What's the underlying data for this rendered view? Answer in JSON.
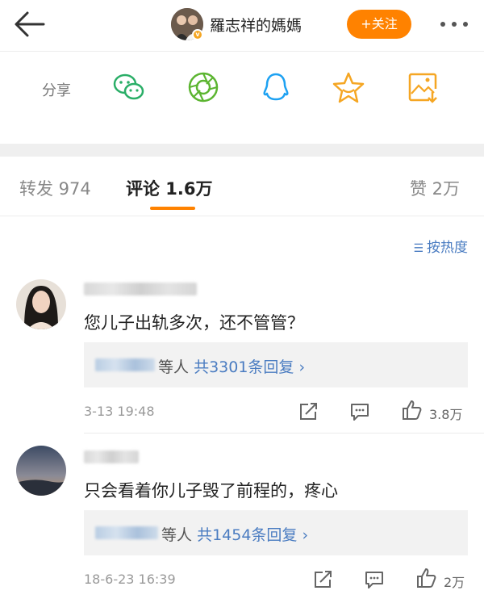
{
  "header": {
    "username": "羅志祥的媽媽",
    "follow_label": "+关注"
  },
  "share": {
    "label": "分享",
    "targets": [
      "wechat",
      "moments",
      "qq",
      "favorite",
      "save-image"
    ]
  },
  "tabs": [
    {
      "label": "转发 974"
    },
    {
      "label": "评论 1.6万"
    },
    {
      "label": "赞 2万"
    }
  ],
  "sort_label": "按热度",
  "comments": [
    {
      "text": "您儿子出轨多次，还不管管？",
      "reply_who": "等人",
      "reply_count": "共3301条回复 ›",
      "time": "3-13 19:48",
      "likes": "3.8万"
    },
    {
      "text": "只会看着你儿子毁了前程的，疼心",
      "reply_who": "等人",
      "reply_count": "共1454条回复 ›",
      "time": "18-6-23 16:39",
      "likes": "2万"
    }
  ],
  "colors": {
    "accent": "#ff8200",
    "link": "#4a7cc1"
  }
}
